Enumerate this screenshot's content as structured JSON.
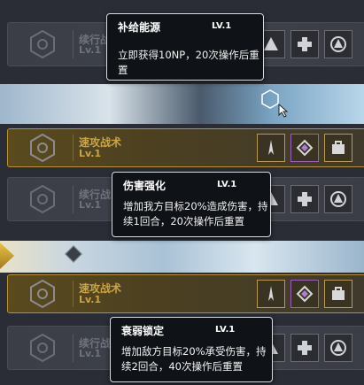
{
  "rows": [
    {
      "name": "续行战",
      "lv": "Lv.1",
      "style": "dark"
    },
    {
      "name": "速攻战术",
      "lv": "Lv.1",
      "style": "gold"
    },
    {
      "name": "续行战",
      "lv": "Lv.1",
      "style": "dark"
    },
    {
      "name": "速攻战术",
      "lv": "Lv.1",
      "style": "gold"
    },
    {
      "name": "续行战",
      "lv": "Lv.1",
      "style": "dark"
    }
  ],
  "tooltips": [
    {
      "title": "补给能源",
      "lv": "LV.1",
      "desc": "立即获得10NP，20次操作后重置"
    },
    {
      "title": "伤害强化",
      "lv": "LV.1",
      "desc_line1": "增加我方目标20%造成伤害，持",
      "desc_line2": "续1回合，20次操作后重置"
    },
    {
      "title": "衰弱锁定",
      "lv": "LV.1",
      "desc_line1": "增加敌方目标20%承受伤害，持",
      "desc_line2": "续2回合，40次操作后重置"
    }
  ],
  "icons": {
    "row_hex": "hex-target-icon",
    "dark_slots": [
      "triangle-emblem-icon",
      "cross-emblem-icon",
      "triangle-ring-icon"
    ],
    "gold_slots": [
      "spike-emblem-icon",
      "diamond-emblem-icon",
      "case-emblem-icon"
    ]
  },
  "colors": {
    "gold": "#c9a547",
    "dim_text": "#6f727c",
    "tooltip_bg": "#0f1217"
  }
}
